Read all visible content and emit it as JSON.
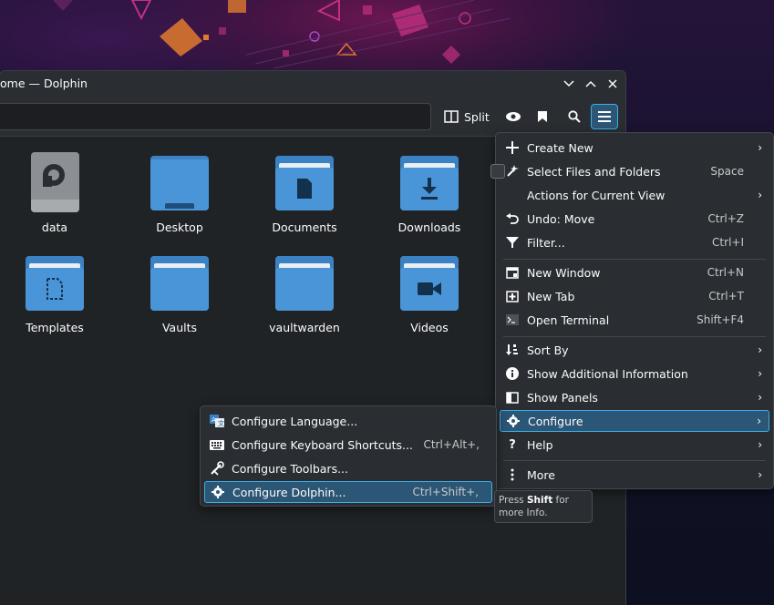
{
  "window": {
    "title": "ome — Dolphin"
  },
  "toolbar": {
    "split_label": "Split"
  },
  "files": [
    {
      "name": "data",
      "icon": "drive-icon"
    },
    {
      "name": "Desktop",
      "icon": "folder-desktop-icon"
    },
    {
      "name": "Documents",
      "icon": "folder-documents-icon"
    },
    {
      "name": "Downloads",
      "icon": "folder-downloads-icon"
    },
    {
      "name": "Templates",
      "icon": "folder-templates-icon"
    },
    {
      "name": "Vaults",
      "icon": "folder-icon"
    },
    {
      "name": "vaultwarden",
      "icon": "folder-icon"
    },
    {
      "name": "Videos",
      "icon": "folder-videos-icon"
    }
  ],
  "main_menu": {
    "items": [
      {
        "label": "Create New",
        "shortcut": "",
        "icon": "plus-icon",
        "submenu": true
      },
      {
        "label": "Select Files and Folders",
        "shortcut": "Space",
        "icon": "select-icon",
        "submenu": false
      },
      {
        "label": "Actions for Current View",
        "shortcut": "",
        "icon": "",
        "submenu": true
      },
      {
        "label": "Undo: Move",
        "shortcut": "Ctrl+Z",
        "icon": "undo-icon",
        "submenu": false
      },
      {
        "label": "Filter...",
        "shortcut": "Ctrl+I",
        "icon": "filter-icon",
        "submenu": false
      },
      {
        "label": "New Window",
        "shortcut": "Ctrl+N",
        "icon": "new-window-icon",
        "submenu": false
      },
      {
        "label": "New Tab",
        "shortcut": "Ctrl+T",
        "icon": "new-tab-icon",
        "submenu": false
      },
      {
        "label": "Open Terminal",
        "shortcut": "Shift+F4",
        "icon": "terminal-icon",
        "submenu": false
      },
      {
        "label": "Sort By",
        "shortcut": "",
        "icon": "sort-icon",
        "submenu": true
      },
      {
        "label": "Show Additional Information",
        "shortcut": "",
        "icon": "info-icon",
        "submenu": true
      },
      {
        "label": "Show Panels",
        "shortcut": "",
        "icon": "panels-icon",
        "submenu": true
      },
      {
        "label": "Configure",
        "shortcut": "",
        "icon": "gear-icon",
        "submenu": true
      },
      {
        "label": "Help",
        "shortcut": "",
        "icon": "help-icon",
        "submenu": true
      },
      {
        "label": "More",
        "shortcut": "",
        "icon": "more-icon",
        "submenu": true
      }
    ]
  },
  "configure_menu": {
    "items": [
      {
        "label": "Configure Language...",
        "shortcut": "",
        "icon": "language-icon"
      },
      {
        "label": "Configure Keyboard Shortcuts...",
        "shortcut": "Ctrl+Alt+,",
        "icon": "keyboard-icon"
      },
      {
        "label": "Configure Toolbars...",
        "shortcut": "",
        "icon": "toolbars-icon"
      },
      {
        "label": "Configure Dolphin...",
        "shortcut": "Ctrl+Shift+,",
        "icon": "gear-icon"
      }
    ]
  },
  "tooltip": {
    "prefix": "Press ",
    "key": "Shift",
    "suffix": " for more Info."
  }
}
